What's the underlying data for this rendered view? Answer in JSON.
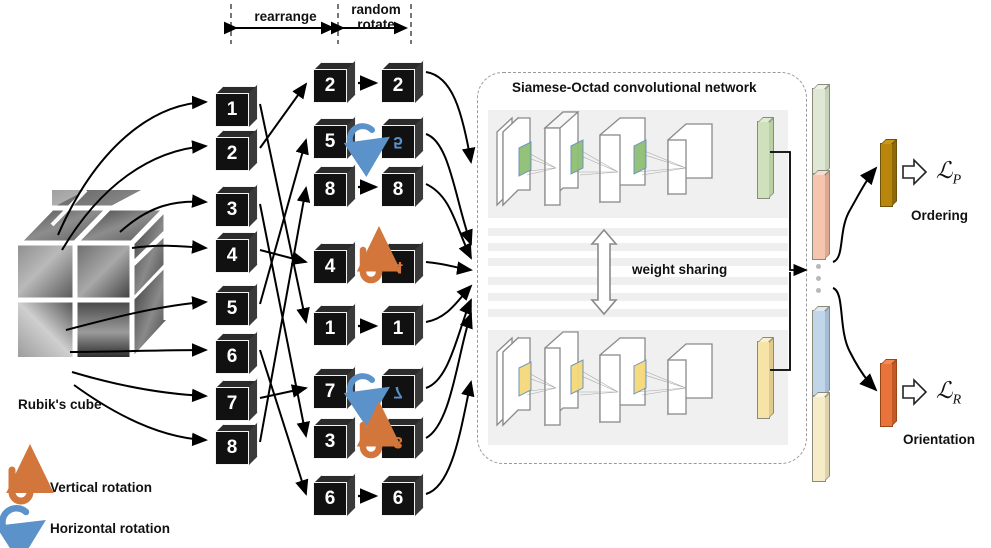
{
  "figure": {
    "phases": [
      {
        "id": "rearrange",
        "label": "rearrange"
      },
      {
        "id": "random-rotate",
        "label": "random\nrotate"
      }
    ],
    "source": {
      "caption": "Rubik's cube",
      "description": "2x2x2 cube of grayscale brain MRI patches"
    },
    "ordered_cubes": [
      {
        "index": 1,
        "label": "1"
      },
      {
        "index": 2,
        "label": "2"
      },
      {
        "index": 3,
        "label": "3"
      },
      {
        "index": 4,
        "label": "4"
      },
      {
        "index": 5,
        "label": "5"
      },
      {
        "index": 6,
        "label": "6"
      },
      {
        "index": 7,
        "label": "7"
      },
      {
        "index": 8,
        "label": "8"
      }
    ],
    "rearranged_cubes": [
      {
        "slot": 1,
        "label": "2",
        "rotation": "none",
        "rotated_label": "2"
      },
      {
        "slot": 2,
        "label": "5",
        "rotation": "horizontal",
        "rotated_label": "5"
      },
      {
        "slot": 3,
        "label": "8",
        "rotation": "none",
        "rotated_label": "8"
      },
      {
        "slot": 4,
        "label": "4",
        "rotation": "vertical",
        "rotated_label": "4"
      },
      {
        "slot": 5,
        "label": "1",
        "rotation": "none",
        "rotated_label": "1"
      },
      {
        "slot": 6,
        "label": "7",
        "rotation": "horizontal",
        "rotated_label": "7"
      },
      {
        "slot": 7,
        "label": "3",
        "rotation": "vertical",
        "rotated_label": "3"
      },
      {
        "slot": 8,
        "label": "6",
        "rotation": "none",
        "rotated_label": "6"
      }
    ],
    "network": {
      "title": "Siamese-Octad convolutional network",
      "weight_sharing_label": "weight sharing",
      "branch_count": 8,
      "visible_branches": 2,
      "hidden_branch_bars": 6,
      "conv_layers_per_branch": 4,
      "top_branch_feature_color": "#cfe0bd",
      "bottom_branch_feature_color": "#f6e3a8"
    },
    "feature_vectors": [
      {
        "order": 1,
        "color": "#dfe8d5",
        "name": "feature-vector-1"
      },
      {
        "order": 2,
        "color": "#f5c5ae",
        "name": "feature-vector-2"
      },
      {
        "order": 3,
        "color": "#c2d6ea",
        "name": "feature-vector-7"
      },
      {
        "order": 4,
        "color": "#f7ecc8",
        "name": "feature-vector-8"
      }
    ],
    "ellipsis": "...",
    "outputs": [
      {
        "id": "ordering",
        "bar_color": "#b8860b",
        "loss_symbol": "L",
        "loss_subscript": "P",
        "task_label": "Ordering"
      },
      {
        "id": "orientation",
        "bar_color": "#e8743b",
        "loss_symbol": "L",
        "loss_subscript": "R",
        "task_label": "Orientation"
      }
    ],
    "legend": [
      {
        "id": "vertical",
        "color": "#d2763c",
        "label": "Vertical rotation"
      },
      {
        "id": "horizontal",
        "color": "#5b92c9",
        "label": "Horizontal rotation"
      }
    ]
  }
}
